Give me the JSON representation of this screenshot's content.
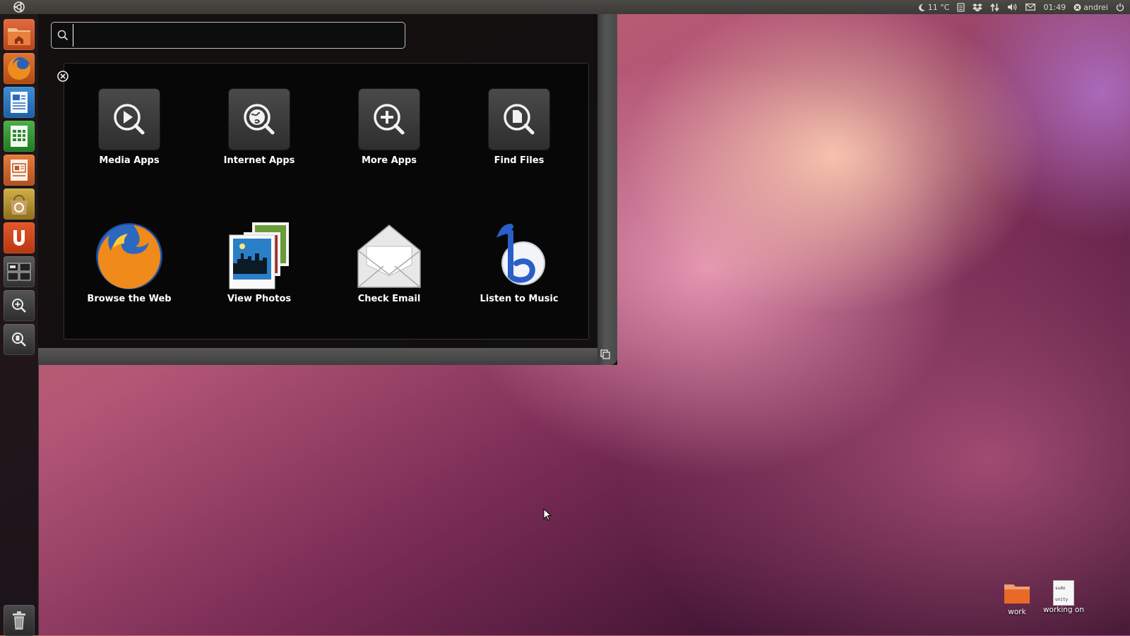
{
  "top_panel": {
    "weather": "11 °C",
    "clock": "01:49",
    "user": "andrei"
  },
  "launcher": {
    "items": [
      {
        "name": "home-folder-icon"
      },
      {
        "name": "firefox-icon"
      },
      {
        "name": "writer-icon"
      },
      {
        "name": "calc-icon"
      },
      {
        "name": "impress-icon"
      },
      {
        "name": "software-center-icon"
      },
      {
        "name": "ubuntu-one-icon"
      },
      {
        "name": "workspace-switcher-icon"
      },
      {
        "name": "applications-lens-icon"
      },
      {
        "name": "files-lens-icon"
      }
    ],
    "trash": {
      "name": "trash-icon"
    }
  },
  "dash": {
    "search": {
      "value": "",
      "placeholder": ""
    },
    "places": [
      {
        "label": "Media Apps",
        "icon": "media-apps-icon"
      },
      {
        "label": "Internet Apps",
        "icon": "internet-apps-icon"
      },
      {
        "label": "More Apps",
        "icon": "more-apps-icon"
      },
      {
        "label": "Find Files",
        "icon": "find-files-icon"
      }
    ],
    "shortcuts": [
      {
        "label": "Browse the Web",
        "icon": "firefox-icon"
      },
      {
        "label": "View Photos",
        "icon": "photos-icon"
      },
      {
        "label": "Check Email",
        "icon": "email-icon"
      },
      {
        "label": "Listen to Music",
        "icon": "banshee-icon"
      }
    ]
  },
  "desktop": {
    "icons": [
      {
        "label": "work",
        "icon": "folder-icon"
      },
      {
        "label": "working on",
        "icon": "text-file-icon",
        "preview_lines": [
          "sudo",
          "unity"
        ]
      }
    ]
  },
  "colors": {
    "panel": "#3b3a36",
    "launcher": "#121012",
    "dash": "#0c0c0c",
    "ubuntu_orange": "#dd4814"
  }
}
